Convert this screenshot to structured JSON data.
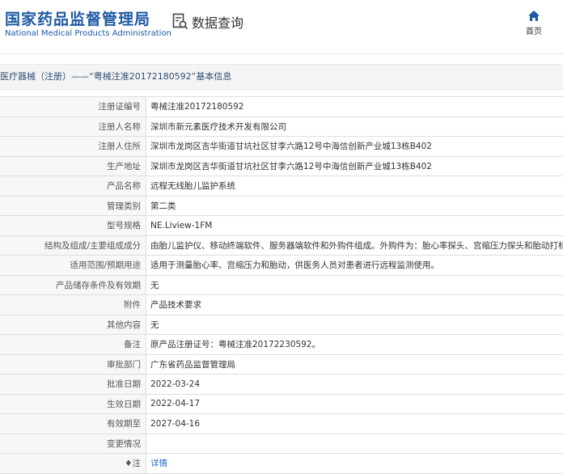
{
  "header": {
    "logo_cn": "国家药品监督管理局",
    "logo_en": "National Medical Products Administration",
    "query_label": "数据查询",
    "home_label": "首页"
  },
  "breadcrumb": "医疗器械（注册）——“粤械注准20172180592”基本信息",
  "rows": [
    {
      "label": "注册证编号",
      "value": "粤械注准20172180592"
    },
    {
      "label": "注册人名称",
      "value": "深圳市新元素医疗技术开发有限公司"
    },
    {
      "label": "注册人住所",
      "value": "深圳市龙岗区吉华街道甘坑社区甘李六路12号中海信创新产业城13栋B402"
    },
    {
      "label": "生产地址",
      "value": "深圳市龙岗区吉华街道甘坑社区甘李六路12号中海信创新产业城13栋B402"
    },
    {
      "label": "产品名称",
      "value": "远程无线胎儿监护系统"
    },
    {
      "label": "管理类别",
      "value": "第二类"
    },
    {
      "label": "型号规格",
      "value": "NE.Liview-1FM"
    },
    {
      "label": "结构及组成/主要组成成分",
      "value": "由胎儿监护仪、移动终端软件、服务器端软件和外购件组成。外购件为：胎心率探头、宫缩压力探头和胎动打标器。"
    },
    {
      "label": "适用范围/预期用途",
      "value": "适用于测量胎心率、宫缩压力和胎动，供医务人员对患者进行远程监测使用。"
    },
    {
      "label": "产品储存条件及有效期",
      "value": "无"
    },
    {
      "label": "附件",
      "value": "产品技术要求"
    },
    {
      "label": "其他内容",
      "value": "无"
    },
    {
      "label": "备注",
      "value": "原产品注册证号：粤械注准20172230592。"
    },
    {
      "label": "审批部门",
      "value": "广东省药品监督管理局"
    },
    {
      "label": "批准日期",
      "value": "2022-03-24"
    },
    {
      "label": "生效日期",
      "value": "2022-04-17"
    },
    {
      "label": "有效期至",
      "value": "2027-04-16"
    },
    {
      "label": "变更情况",
      "value": ""
    }
  ],
  "note_row": {
    "pin_glyph": "♦",
    "label": "注",
    "link_text": "详情"
  }
}
